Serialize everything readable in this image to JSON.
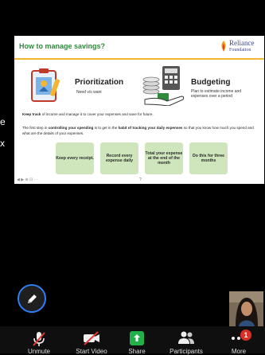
{
  "slide": {
    "title": "How to manage savings?",
    "logo_line1": "Reliance",
    "logo_line2": "Foundation",
    "prioritization_title": "Prioritization",
    "prioritization_sub": "Need v/s want",
    "budgeting_title": "Budgeting",
    "budgeting_sub": "Plan to estimate income and expenses over a period",
    "para1_bold": "Keep track",
    "para1_rest": " of income and manage it to cover your expenses and save for future.",
    "para2_a": "The first step in ",
    "para2_b": "controlling your spending",
    "para2_c": " is to get in the ",
    "para2_d": "habit of tracking your daily expenses",
    "para2_e": " so that you know how much you spend and what are the details of your expenses.",
    "steps": [
      "Keep every receipt.",
      "Record every expense daily",
      "Total your expense at the end of the month",
      "Do this for three months"
    ],
    "controls": "◀ ▶ ⊕ ⊡ ⋯",
    "mid_mark": "?"
  },
  "side_text": [
    "e",
    "x"
  ],
  "toolbar": {
    "unmute": "Unmute",
    "start_video": "Start Video",
    "share": "Share",
    "participants": "Participants",
    "more": "More",
    "more_badge": "1"
  },
  "colors": {
    "accent_green": "#2e8b3a",
    "step_green": "#cfe6bd",
    "annotate_ring": "#2f7ef7",
    "share_green": "#22b04b",
    "mute_red": "#e53935",
    "badge_red": "#d93025"
  },
  "icons": [
    "clipboard-icon",
    "coins-calculator-icon",
    "pencil-icon",
    "microphone-muted-icon",
    "video-off-icon",
    "share-arrow-icon",
    "participants-icon",
    "more-icon"
  ]
}
